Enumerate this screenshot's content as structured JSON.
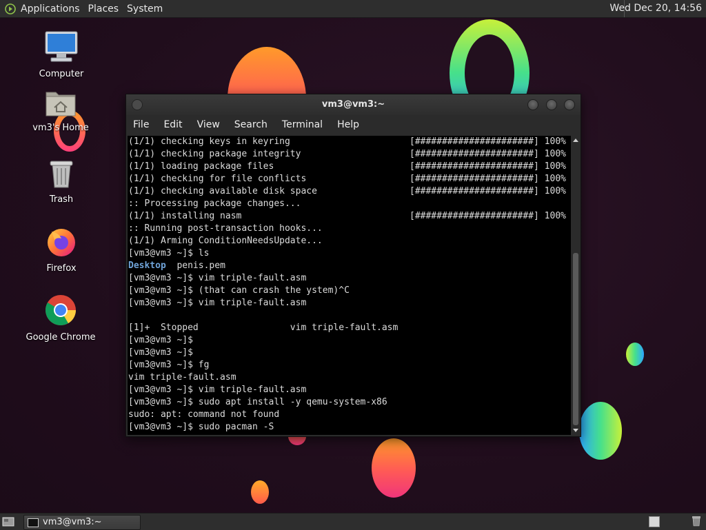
{
  "top_panel": {
    "menus": [
      "Applications",
      "Places",
      "System"
    ],
    "clock": "Wed Dec 20, 14:56"
  },
  "desktop_icons": [
    {
      "label": "Computer",
      "icon": "computer-icon"
    },
    {
      "label": "vm3's Home",
      "icon": "home-folder-icon"
    },
    {
      "label": "Trash",
      "icon": "trash-icon"
    },
    {
      "label": "Firefox",
      "icon": "firefox-icon"
    },
    {
      "label": "Google Chrome",
      "icon": "chrome-icon"
    }
  ],
  "terminal": {
    "title": "vm3@vm3:~",
    "menus": [
      "File",
      "Edit",
      "View",
      "Search",
      "Terminal",
      "Help"
    ],
    "lines": [
      {
        "text": "(1/1) checking keys in keyring",
        "progress": "[######################] 100%"
      },
      {
        "text": "(1/1) checking package integrity",
        "progress": "[######################] 100%"
      },
      {
        "text": "(1/1) loading package files",
        "progress": "[######################] 100%"
      },
      {
        "text": "(1/1) checking for file conflicts",
        "progress": "[######################] 100%"
      },
      {
        "text": "(1/1) checking available disk space",
        "progress": "[######################] 100%"
      },
      {
        "text": ":: Processing package changes...",
        "progress": ""
      },
      {
        "text": "(1/1) installing nasm",
        "progress": "[######################] 100%"
      },
      {
        "text": ":: Running post-transaction hooks...",
        "progress": ""
      },
      {
        "text": "(1/1) Arming ConditionNeedsUpdate...",
        "progress": ""
      },
      {
        "text": "[vm3@vm3 ~]$ ls",
        "progress": ""
      },
      {
        "dir": "Desktop",
        "text": "  penis.pem",
        "progress": ""
      },
      {
        "text": "[vm3@vm3 ~]$ vim triple-fault.asm",
        "progress": ""
      },
      {
        "text": "[vm3@vm3 ~]$ (that can crash the ystem)^C",
        "progress": ""
      },
      {
        "text": "[vm3@vm3 ~]$ vim triple-fault.asm",
        "progress": ""
      },
      {
        "text": "",
        "progress": ""
      },
      {
        "text": "[1]+  Stopped                 vim triple-fault.asm",
        "progress": ""
      },
      {
        "text": "[vm3@vm3 ~]$",
        "progress": ""
      },
      {
        "text": "[vm3@vm3 ~]$",
        "progress": ""
      },
      {
        "text": "[vm3@vm3 ~]$ fg",
        "progress": ""
      },
      {
        "text": "vim triple-fault.asm",
        "progress": ""
      },
      {
        "text": "[vm3@vm3 ~]$ vim triple-fault.asm",
        "progress": ""
      },
      {
        "text": "[vm3@vm3 ~]$ sudo apt install -y qemu-system-x86",
        "progress": ""
      },
      {
        "text": "sudo: apt: command not found",
        "progress": ""
      },
      {
        "text": "[vm3@vm3 ~]$ sudo pacman -S",
        "progress": ""
      }
    ]
  },
  "taskbar": {
    "task_label": "vm3@vm3:~"
  }
}
